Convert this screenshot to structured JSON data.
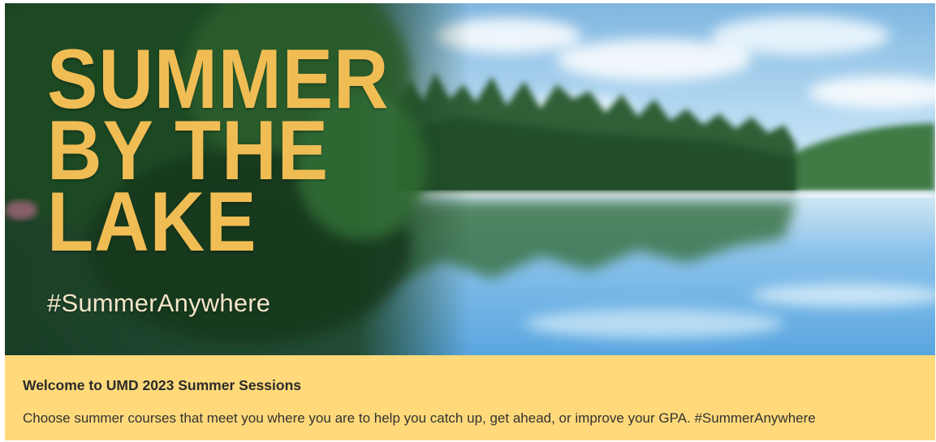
{
  "hero": {
    "title_lines": [
      "SUMMER",
      "BY THE",
      "LAKE"
    ],
    "hashtag": "#SummerAnywhere",
    "colors": {
      "title": "#f0bd55",
      "hashtag": "#f3e6c8",
      "sky": "#8fc3e8",
      "forest": "#1f4a25",
      "water": "#6fb4e6"
    }
  },
  "banner": {
    "heading": "Welcome to UMD 2023 Summer Sessions",
    "text": "Choose summer courses that meet you where you are to help you catch up, get ahead, or improve your GPA. #SummerAnywhere",
    "background": "#ffd97a"
  }
}
